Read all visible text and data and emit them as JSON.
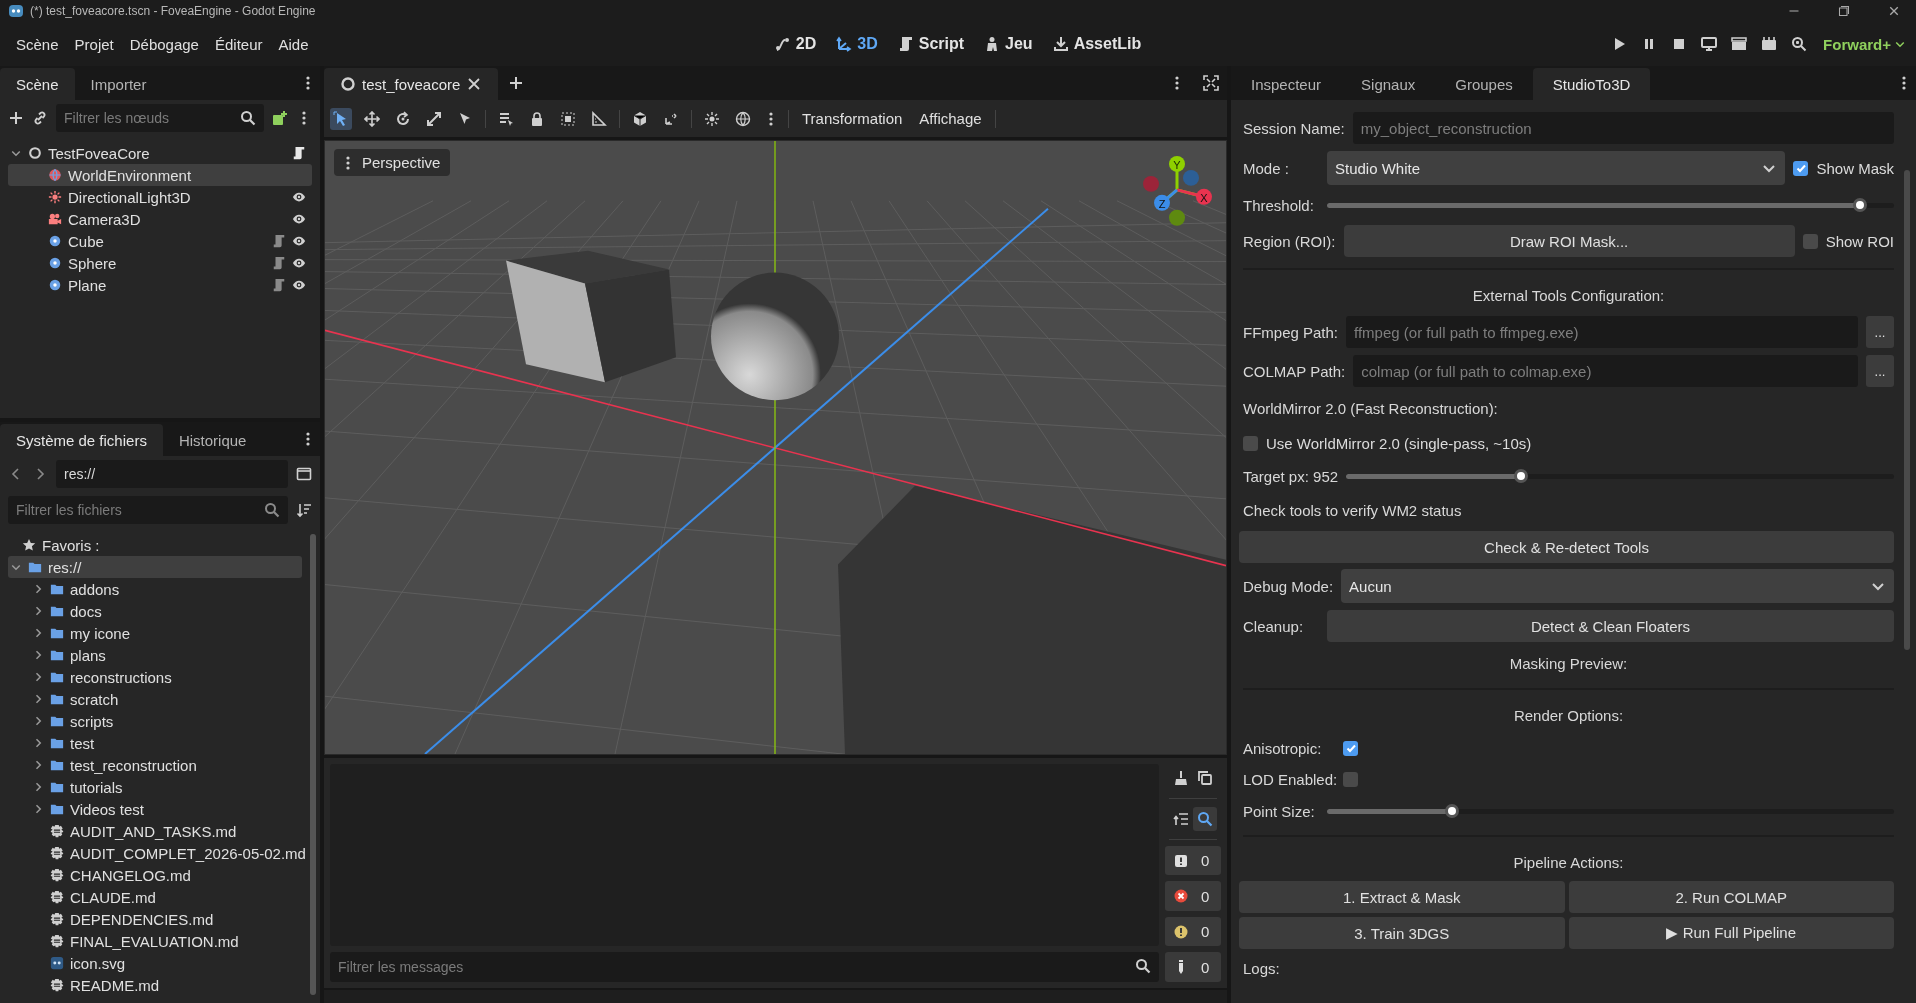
{
  "window": {
    "title": "(*) test_foveacore.tscn - FoveaEngine - Godot Engine"
  },
  "menus": [
    "Scène",
    "Projet",
    "Débogage",
    "Éditeur",
    "Aide"
  ],
  "workspaces": [
    {
      "kind": "canvas",
      "label": "2D",
      "selected": false
    },
    {
      "kind": "spatial",
      "label": "3D",
      "selected": true
    },
    {
      "kind": "script",
      "label": "Script",
      "selected": false
    },
    {
      "kind": "game",
      "label": "Jeu",
      "selected": false
    },
    {
      "kind": "assetlib",
      "label": "AssetLib",
      "selected": false
    }
  ],
  "renderer": "Forward+",
  "scene_dock": {
    "tabs": [
      {
        "label": "Scène",
        "selected": true
      },
      {
        "label": "Importer",
        "selected": false
      }
    ],
    "filter": {
      "placeholder": "Filtrer les nœuds"
    },
    "tree": [
      {
        "name": "TestFoveaCore",
        "kind": "root",
        "selected": false,
        "script": true,
        "visibility_toggle": false,
        "expanded": true,
        "children": [
          {
            "name": "WorldEnvironment",
            "kind": "environment",
            "selected": true,
            "script": false,
            "visibility_toggle": false
          },
          {
            "name": "DirectionalLight3D",
            "kind": "light",
            "selected": false,
            "script": false,
            "visibility_toggle": true
          },
          {
            "name": "Camera3D",
            "kind": "camera",
            "selected": false,
            "script": false,
            "visibility_toggle": true
          },
          {
            "name": "Cube",
            "kind": "mesh",
            "selected": false,
            "script": true,
            "visibility_toggle": true
          },
          {
            "name": "Sphere",
            "kind": "mesh",
            "selected": false,
            "script": true,
            "visibility_toggle": true
          },
          {
            "name": "Plane",
            "kind": "mesh",
            "selected": false,
            "script": true,
            "visibility_toggle": true
          }
        ]
      }
    ]
  },
  "filesystem_dock": {
    "tabs": [
      {
        "label": "Système de fichiers",
        "selected": true
      },
      {
        "label": "Historique",
        "selected": false
      }
    ],
    "path": "res://",
    "filter": {
      "placeholder": "Filtrer les fichiers"
    },
    "favorites": "Favoris :",
    "tree": [
      {
        "name": "res://",
        "kind": "folder",
        "selected": true,
        "expanded": true,
        "children": [
          {
            "name": "addons",
            "kind": "folder",
            "selected": false,
            "expanded": false
          },
          {
            "name": "docs",
            "kind": "folder",
            "selected": false,
            "expanded": false
          },
          {
            "name": "my icone",
            "kind": "folder",
            "selected": false,
            "expanded": false
          },
          {
            "name": "plans",
            "kind": "folder",
            "selected": false,
            "expanded": false
          },
          {
            "name": "reconstructions",
            "kind": "folder",
            "selected": false,
            "expanded": false
          },
          {
            "name": "scratch",
            "kind": "folder",
            "selected": false,
            "expanded": false
          },
          {
            "name": "scripts",
            "kind": "folder",
            "selected": false,
            "expanded": false
          },
          {
            "name": "test",
            "kind": "folder",
            "selected": false,
            "expanded": false
          },
          {
            "name": "test_reconstruction",
            "kind": "folder",
            "selected": false,
            "expanded": false
          },
          {
            "name": "tutorials",
            "kind": "folder",
            "selected": false,
            "expanded": false
          },
          {
            "name": "Videos test",
            "kind": "folder",
            "selected": false,
            "expanded": false
          },
          {
            "name": "AUDIT_AND_TASKS.md",
            "kind": "text_file",
            "selected": false
          },
          {
            "name": "AUDIT_COMPLET_2026-05-02.md",
            "kind": "text_file",
            "selected": false
          },
          {
            "name": "CHANGELOG.md",
            "kind": "text_file",
            "selected": false
          },
          {
            "name": "CLAUDE.md",
            "kind": "text_file",
            "selected": false
          },
          {
            "name": "DEPENDENCIES.md",
            "kind": "text_file",
            "selected": false
          },
          {
            "name": "FINAL_EVALUATION.md",
            "kind": "text_file",
            "selected": false
          },
          {
            "name": "icon.svg",
            "kind": "image_file",
            "selected": false
          },
          {
            "name": "README.md",
            "kind": "text_file",
            "selected": false
          }
        ]
      }
    ]
  },
  "editor_tabs": [
    {
      "label": "test_foveacore",
      "selected": true
    }
  ],
  "viewport_toolbar": {
    "tools": [
      {
        "kind": "select",
        "selected": true
      },
      {
        "kind": "move",
        "selected": false
      },
      {
        "kind": "rotate",
        "selected": false
      },
      {
        "kind": "scale",
        "selected": false
      },
      {
        "kind": "pointer",
        "selected": false
      },
      {
        "kind": "list",
        "selected": false
      },
      {
        "kind": "lock",
        "selected": false
      },
      {
        "kind": "group",
        "selected": false
      },
      {
        "kind": "ruler",
        "selected": false
      },
      {
        "kind": "cube",
        "selected": false
      },
      {
        "kind": "snap",
        "selected": false
      },
      {
        "kind": "sun",
        "selected": false
      },
      {
        "kind": "globe",
        "selected": false
      }
    ],
    "menus": [
      "Transformation",
      "Affichage"
    ]
  },
  "viewport": {
    "view_menu": "Perspective",
    "gizmo_labels": [
      "Y",
      "Z",
      "X"
    ]
  },
  "output": {
    "search_toggle": true,
    "filter": {
      "placeholder": "Filtrer les messages"
    },
    "counters": [
      {
        "kind": "message",
        "count": "0"
      },
      {
        "kind": "error",
        "count": "0"
      },
      {
        "kind": "warning",
        "count": "0"
      },
      {
        "kind": "info",
        "count": "0"
      }
    ]
  },
  "inspector": {
    "tabs": [
      {
        "label": "Inspecteur",
        "selected": false
      },
      {
        "label": "Signaux",
        "selected": false
      },
      {
        "label": "Groupes",
        "selected": false
      },
      {
        "label": "StudioTo3D",
        "selected": true
      }
    ],
    "rows": [
      {
        "kind": "field",
        "label": "Session Name:",
        "placeholder": "my_object_reconstruction"
      },
      {
        "kind": "dropdown",
        "label": "Mode :",
        "value": "Studio White",
        "check": {
          "label": "Show Mask",
          "checked": true
        }
      },
      {
        "kind": "slider",
        "label": "Threshold:",
        "level": 0.94
      },
      {
        "kind": "button",
        "label": "Region (ROI):",
        "button": "Draw ROI Mask...",
        "check": {
          "label": "Show ROI",
          "checked": false
        }
      },
      {
        "kind": "separator"
      },
      {
        "kind": "heading",
        "text": "External Tools Configuration:"
      },
      {
        "kind": "path",
        "label": "FFmpeg Path:",
        "placeholder": "ffmpeg (or full path to ffmpeg.exe)",
        "browse": "..."
      },
      {
        "kind": "path",
        "label": "COLMAP Path:",
        "placeholder": "colmap (or full path to colmap.exe)",
        "browse": "..."
      },
      {
        "kind": "text",
        "text": "WorldMirror 2.0 (Fast Reconstruction):"
      },
      {
        "kind": "checkbox",
        "label": "Use WorldMirror 2.0 (single-pass, ~10s)",
        "checked": false
      },
      {
        "kind": "slider",
        "label": "Target px: 952",
        "level": 0.32
      },
      {
        "kind": "text",
        "text": "Check tools to verify WM2 status"
      },
      {
        "kind": "wide_button",
        "button": "Check & Re-detect Tools"
      },
      {
        "kind": "dropdown",
        "label": "Debug Mode:",
        "value": "Aucun"
      },
      {
        "kind": "button",
        "label": "Cleanup:",
        "button": "Detect & Clean Floaters"
      },
      {
        "kind": "heading",
        "text": "Masking Preview:"
      },
      {
        "kind": "separator"
      },
      {
        "kind": "heading",
        "text": "Render Options:"
      },
      {
        "kind": "check_row",
        "label": "Anisotropic:",
        "checked": true
      },
      {
        "kind": "check_row",
        "label": "LOD Enabled:",
        "checked": false
      },
      {
        "kind": "slider",
        "label": "Point Size:",
        "level": 0.22
      },
      {
        "kind": "separator"
      },
      {
        "kind": "heading",
        "text": "Pipeline Actions:"
      },
      {
        "kind": "button_grid",
        "buttons": [
          "1. Extract & Mask",
          "2. Run COLMAP",
          "3. Train 3DGS",
          "▶ Run Full Pipeline"
        ]
      },
      {
        "kind": "text",
        "text": "Logs:"
      }
    ]
  }
}
